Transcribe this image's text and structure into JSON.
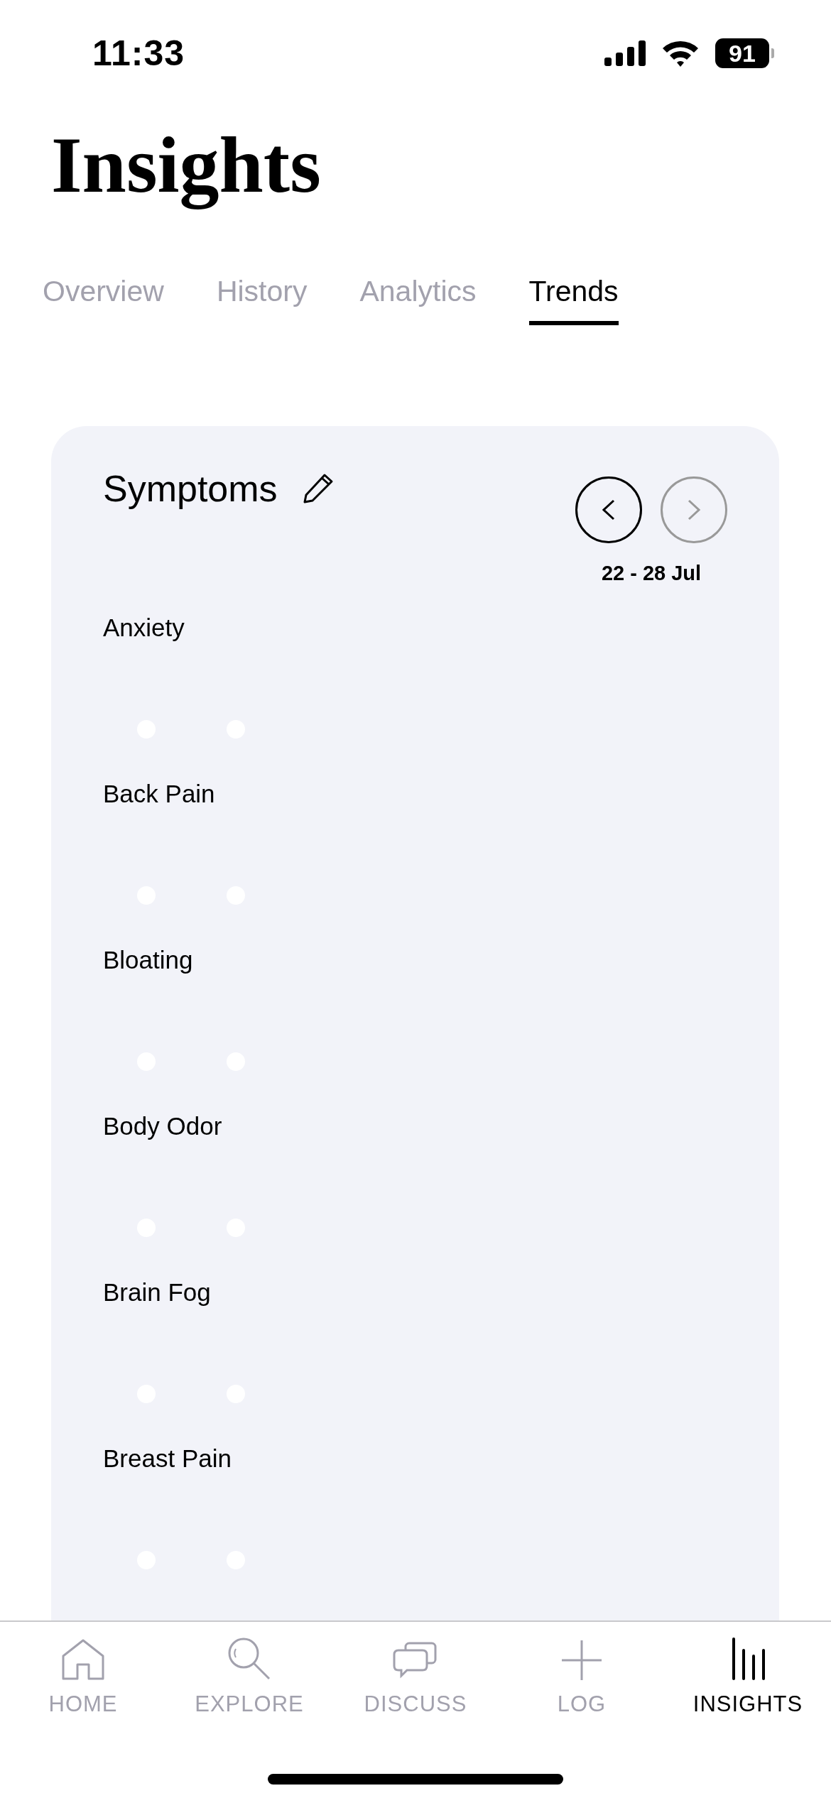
{
  "status_bar": {
    "time": "11:33",
    "battery": "91"
  },
  "title": "Insights",
  "tabs": [
    {
      "label": "Overview",
      "selected": false
    },
    {
      "label": "History",
      "selected": false
    },
    {
      "label": "Analytics",
      "selected": false
    },
    {
      "label": "Trends",
      "selected": true
    }
  ],
  "card": {
    "title": "Symptoms",
    "date_range": "22 - 28 Jul",
    "prev_enabled": true,
    "next_enabled": false,
    "symptoms": [
      {
        "name": "Anxiety"
      },
      {
        "name": "Back Pain"
      },
      {
        "name": "Bloating"
      },
      {
        "name": "Body Odor"
      },
      {
        "name": "Brain Fog"
      },
      {
        "name": "Breast Pain"
      }
    ]
  },
  "nav": [
    {
      "label": "HOME",
      "kind": "home",
      "selected": false
    },
    {
      "label": "EXPLORE",
      "kind": "explore",
      "selected": false
    },
    {
      "label": "DISCUSS",
      "kind": "discuss",
      "selected": false
    },
    {
      "label": "LOG",
      "kind": "log",
      "selected": false
    },
    {
      "label": "INSIGHTS",
      "kind": "insights",
      "selected": true
    }
  ]
}
